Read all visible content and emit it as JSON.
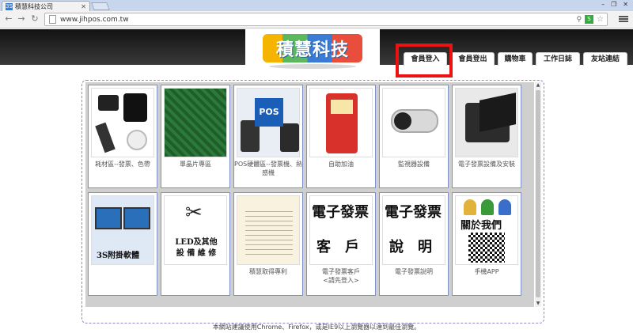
{
  "browser": {
    "tab_title": "積慧科技公司",
    "tab_favicon": "3S",
    "url": "www.jihpos.com.tw",
    "window_controls": [
      "–",
      "❐",
      "✕"
    ]
  },
  "site": {
    "logo_text": "積慧科技",
    "nav": [
      {
        "label": "會員登入"
      },
      {
        "label": "會員登出"
      },
      {
        "label": "購物車"
      },
      {
        "label": "工作日誌"
      },
      {
        "label": "友站連結"
      }
    ],
    "tiles": [
      {
        "caption": "耗材區--發票、色帶",
        "image": "consumables"
      },
      {
        "caption": "單晶片專區",
        "image": "circuit-board"
      },
      {
        "caption": "POS硬體區--發票機、熱感機",
        "image": "pos-hardware",
        "badge": "POS"
      },
      {
        "caption": "自助加油",
        "image": "gas-pump"
      },
      {
        "caption": "監視器設備",
        "image": "security-camera"
      },
      {
        "caption": "電子發票設備及安裝",
        "image": "invoice-printer"
      },
      {
        "caption": "",
        "image": "monitors",
        "text": "3S附掛軟體"
      },
      {
        "caption": "",
        "image": "tools",
        "text_line1": "LED及其他",
        "text_line2": "設 備 維 修"
      },
      {
        "caption": "積慧取得專利",
        "image": "certificate"
      },
      {
        "caption_line1": "電子發票客戶",
        "caption_line2": "<請先登入>",
        "image": "text-tile",
        "big_line1": "電子發票",
        "big_line2": "客　戶"
      },
      {
        "caption": "電子發票說明",
        "image": "text-tile",
        "big_line1": "電子發票",
        "big_line2": "說　明"
      },
      {
        "caption": "手機APP",
        "image": "about-us",
        "text": "關於我們"
      }
    ],
    "footer": "本網站建議使用Chrome、Firefox，或是IE9以上瀏覽器以達到最佳瀏覽。"
  },
  "colors": {
    "header_dark": "#121212",
    "highlight": "#ee1111",
    "tile_border": "#7f8fc8"
  }
}
